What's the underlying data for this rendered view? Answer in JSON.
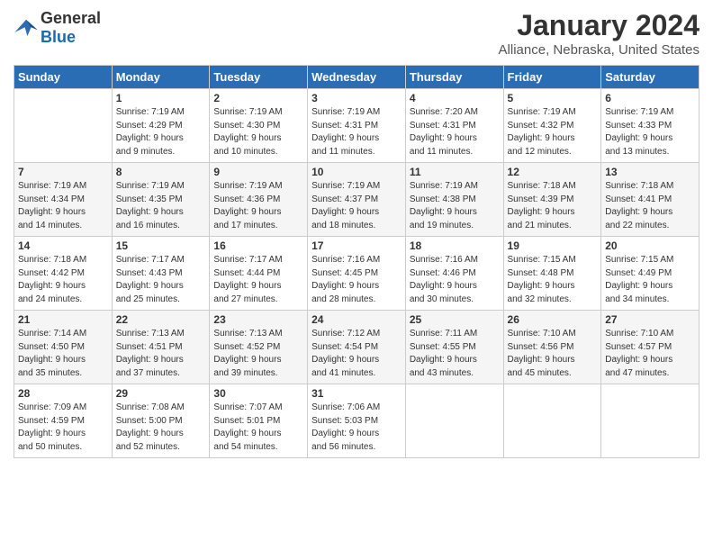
{
  "header": {
    "logo_general": "General",
    "logo_blue": "Blue",
    "month": "January 2024",
    "location": "Alliance, Nebraska, United States"
  },
  "days_of_week": [
    "Sunday",
    "Monday",
    "Tuesday",
    "Wednesday",
    "Thursday",
    "Friday",
    "Saturday"
  ],
  "weeks": [
    [
      {
        "day": "",
        "info": ""
      },
      {
        "day": "1",
        "info": "Sunrise: 7:19 AM\nSunset: 4:29 PM\nDaylight: 9 hours\nand 9 minutes."
      },
      {
        "day": "2",
        "info": "Sunrise: 7:19 AM\nSunset: 4:30 PM\nDaylight: 9 hours\nand 10 minutes."
      },
      {
        "day": "3",
        "info": "Sunrise: 7:19 AM\nSunset: 4:31 PM\nDaylight: 9 hours\nand 11 minutes."
      },
      {
        "day": "4",
        "info": "Sunrise: 7:20 AM\nSunset: 4:31 PM\nDaylight: 9 hours\nand 11 minutes."
      },
      {
        "day": "5",
        "info": "Sunrise: 7:19 AM\nSunset: 4:32 PM\nDaylight: 9 hours\nand 12 minutes."
      },
      {
        "day": "6",
        "info": "Sunrise: 7:19 AM\nSunset: 4:33 PM\nDaylight: 9 hours\nand 13 minutes."
      }
    ],
    [
      {
        "day": "7",
        "info": "Sunrise: 7:19 AM\nSunset: 4:34 PM\nDaylight: 9 hours\nand 14 minutes."
      },
      {
        "day": "8",
        "info": "Sunrise: 7:19 AM\nSunset: 4:35 PM\nDaylight: 9 hours\nand 16 minutes."
      },
      {
        "day": "9",
        "info": "Sunrise: 7:19 AM\nSunset: 4:36 PM\nDaylight: 9 hours\nand 17 minutes."
      },
      {
        "day": "10",
        "info": "Sunrise: 7:19 AM\nSunset: 4:37 PM\nDaylight: 9 hours\nand 18 minutes."
      },
      {
        "day": "11",
        "info": "Sunrise: 7:19 AM\nSunset: 4:38 PM\nDaylight: 9 hours\nand 19 minutes."
      },
      {
        "day": "12",
        "info": "Sunrise: 7:18 AM\nSunset: 4:39 PM\nDaylight: 9 hours\nand 21 minutes."
      },
      {
        "day": "13",
        "info": "Sunrise: 7:18 AM\nSunset: 4:41 PM\nDaylight: 9 hours\nand 22 minutes."
      }
    ],
    [
      {
        "day": "14",
        "info": "Sunrise: 7:18 AM\nSunset: 4:42 PM\nDaylight: 9 hours\nand 24 minutes."
      },
      {
        "day": "15",
        "info": "Sunrise: 7:17 AM\nSunset: 4:43 PM\nDaylight: 9 hours\nand 25 minutes."
      },
      {
        "day": "16",
        "info": "Sunrise: 7:17 AM\nSunset: 4:44 PM\nDaylight: 9 hours\nand 27 minutes."
      },
      {
        "day": "17",
        "info": "Sunrise: 7:16 AM\nSunset: 4:45 PM\nDaylight: 9 hours\nand 28 minutes."
      },
      {
        "day": "18",
        "info": "Sunrise: 7:16 AM\nSunset: 4:46 PM\nDaylight: 9 hours\nand 30 minutes."
      },
      {
        "day": "19",
        "info": "Sunrise: 7:15 AM\nSunset: 4:48 PM\nDaylight: 9 hours\nand 32 minutes."
      },
      {
        "day": "20",
        "info": "Sunrise: 7:15 AM\nSunset: 4:49 PM\nDaylight: 9 hours\nand 34 minutes."
      }
    ],
    [
      {
        "day": "21",
        "info": "Sunrise: 7:14 AM\nSunset: 4:50 PM\nDaylight: 9 hours\nand 35 minutes."
      },
      {
        "day": "22",
        "info": "Sunrise: 7:13 AM\nSunset: 4:51 PM\nDaylight: 9 hours\nand 37 minutes."
      },
      {
        "day": "23",
        "info": "Sunrise: 7:13 AM\nSunset: 4:52 PM\nDaylight: 9 hours\nand 39 minutes."
      },
      {
        "day": "24",
        "info": "Sunrise: 7:12 AM\nSunset: 4:54 PM\nDaylight: 9 hours\nand 41 minutes."
      },
      {
        "day": "25",
        "info": "Sunrise: 7:11 AM\nSunset: 4:55 PM\nDaylight: 9 hours\nand 43 minutes."
      },
      {
        "day": "26",
        "info": "Sunrise: 7:10 AM\nSunset: 4:56 PM\nDaylight: 9 hours\nand 45 minutes."
      },
      {
        "day": "27",
        "info": "Sunrise: 7:10 AM\nSunset: 4:57 PM\nDaylight: 9 hours\nand 47 minutes."
      }
    ],
    [
      {
        "day": "28",
        "info": "Sunrise: 7:09 AM\nSunset: 4:59 PM\nDaylight: 9 hours\nand 50 minutes."
      },
      {
        "day": "29",
        "info": "Sunrise: 7:08 AM\nSunset: 5:00 PM\nDaylight: 9 hours\nand 52 minutes."
      },
      {
        "day": "30",
        "info": "Sunrise: 7:07 AM\nSunset: 5:01 PM\nDaylight: 9 hours\nand 54 minutes."
      },
      {
        "day": "31",
        "info": "Sunrise: 7:06 AM\nSunset: 5:03 PM\nDaylight: 9 hours\nand 56 minutes."
      },
      {
        "day": "",
        "info": ""
      },
      {
        "day": "",
        "info": ""
      },
      {
        "day": "",
        "info": ""
      }
    ]
  ]
}
